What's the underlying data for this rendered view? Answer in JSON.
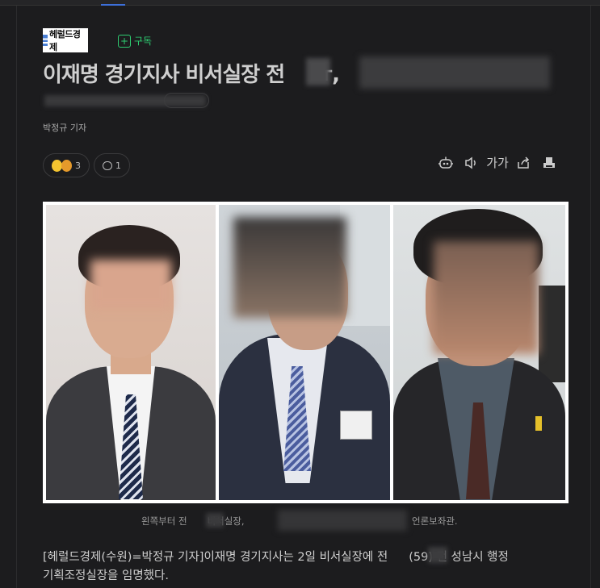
{
  "press": {
    "name": "헤럴드경제",
    "subscribe_label": "구독"
  },
  "article": {
    "headline_visible": "이재명 경기지사 비서실장 전",
    "headline_tail": "ㅠ,",
    "reporter": "박정규 기자",
    "reaction_count": "3",
    "comment_count": "1",
    "font_size_label": "가가",
    "caption_left": "왼쪽부터 전",
    "caption_mid": "비서실장,",
    "caption_right": "언론보좌관.",
    "body_line1_a": "[헤럴드경제(수원)=박정규 기자]이재명 경기지사는 2일 비서실장에 전",
    "body_line1_b": "(59) 전 성남시 행정",
    "body_line2": "기획조정실장을 임명했다."
  },
  "toolbar": {
    "icons": [
      "summary-bot-icon",
      "speaker-icon",
      "font-size-icon",
      "share-icon",
      "print-icon"
    ]
  },
  "colors": {
    "background": "#1c1c1e",
    "subscribe": "#2ecc71",
    "text": "#cfcfcf"
  }
}
